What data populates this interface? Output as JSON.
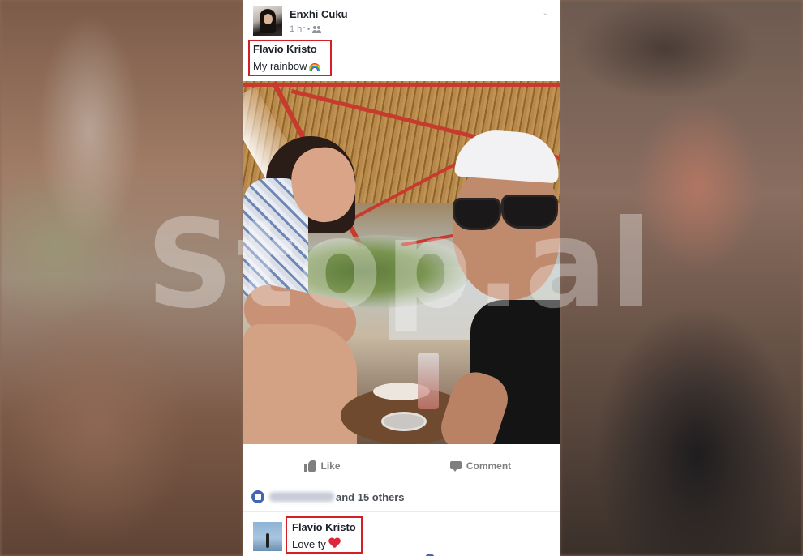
{
  "post": {
    "author": "Enxhi Cuku",
    "timestamp": "1 hr",
    "privacy_icon": "friends-icon",
    "tag": {
      "name": "Flavio Kristo",
      "text": "My rainbow",
      "emoji_icon": "rainbow-icon"
    },
    "photo": {
      "watermark": "Stop.al"
    }
  },
  "actions": {
    "like_label": "Like",
    "comment_label": "Comment"
  },
  "likes": {
    "others_text": "and 15 others"
  },
  "comment": {
    "author": "Flavio Kristo",
    "text": "Love ty",
    "emoji_icon": "heart-icon"
  },
  "colors": {
    "highlight_box": "#d32027",
    "facebook_blue": "#4267b2"
  }
}
